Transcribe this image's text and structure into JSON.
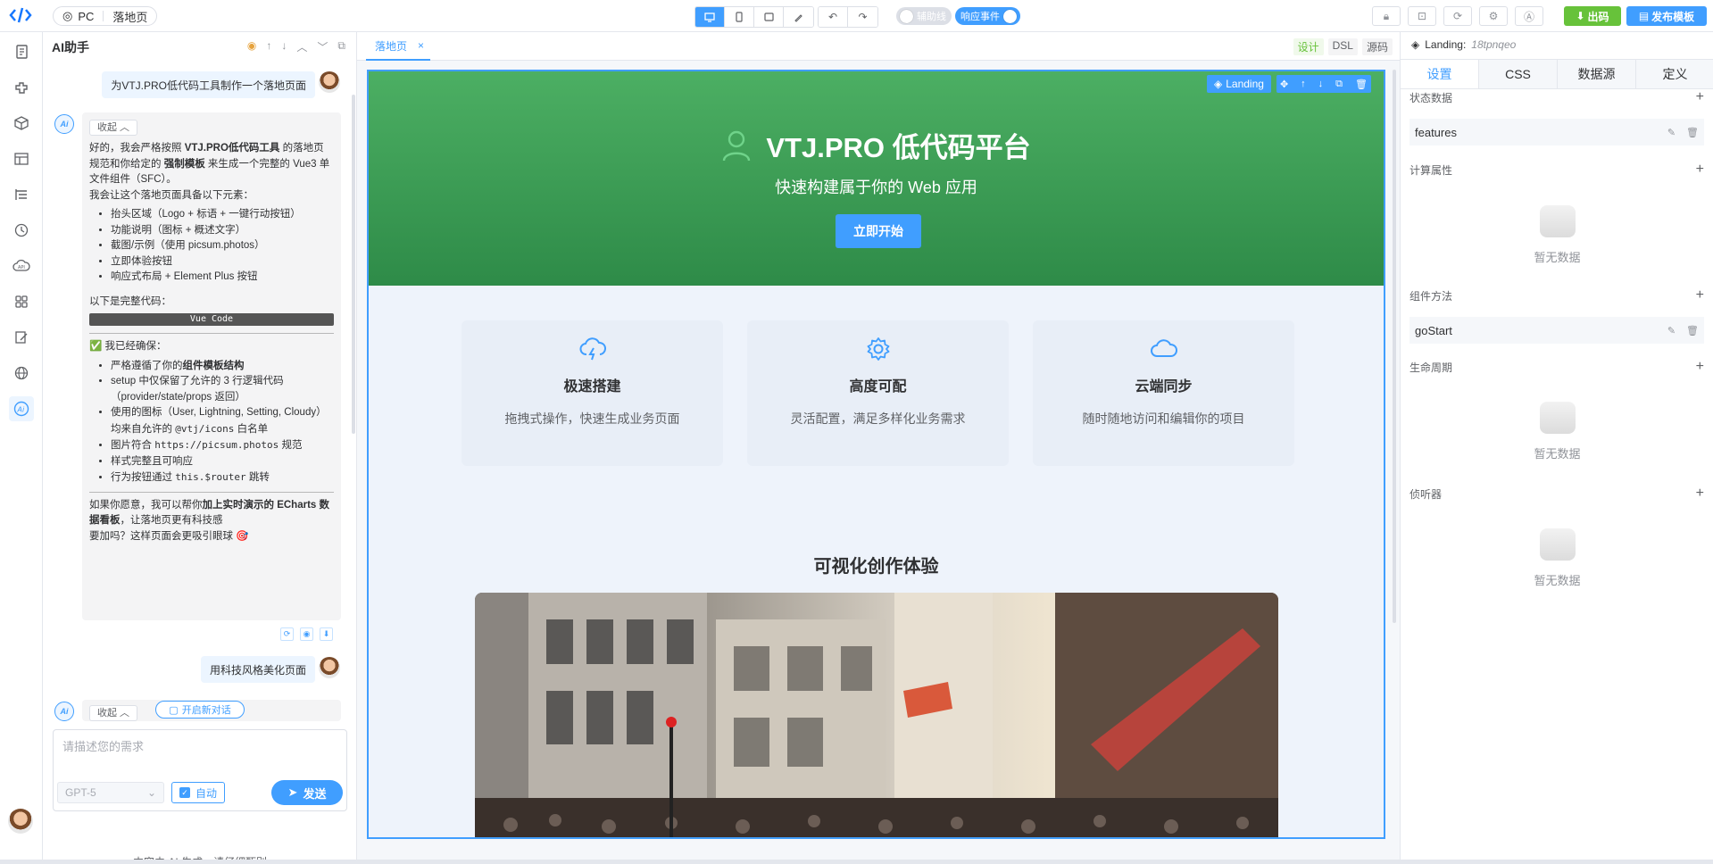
{
  "topbar": {
    "platform": "PC",
    "page_name": "落地页",
    "toggle_guides": "辅助线",
    "toggle_events": "响应事件",
    "export_label": "出码",
    "publish_label": "发布模板"
  },
  "chat": {
    "title": "AI助手",
    "messages": [
      {
        "role": "user",
        "text": "为VTJ.PRO低代码工具制作一个落地页面"
      },
      {
        "role": "ai",
        "collapse": "收起"
      },
      {
        "role": "user",
        "text": "用科技风格美化页面"
      },
      {
        "role": "ai",
        "collapse": "收起"
      }
    ],
    "ai_reply": {
      "p1_a": "好的，我会严格按照 ",
      "p1_b": "VTJ.PRO低代码工具",
      "p1_c": " 的落地页规范和你给定的 ",
      "p1_d": "强制模板",
      "p1_e": " 来生成一个完整的 Vue3 单文件组件（SFC）。",
      "p2": "我会让这个落地页面具备以下元素：",
      "list1": [
        "抬头区域（Logo + 标语 + 一键行动按钮）",
        "功能说明（图标 + 概述文字）",
        "截图/示例（使用 picsum.photos）",
        "立即体验按钮",
        "响应式布局 + Element Plus 按钮"
      ],
      "p3": "以下是完整代码：",
      "code_label": "Vue Code",
      "p4": "✅ 我已经确保：",
      "list2_0_a": "严格遵循了你的",
      "list2_0_b": "组件模板结构",
      "list2_1": "setup 中仅保留了允许的 3 行逻辑代码（provider/state/props 返回）",
      "list2_2_a": "使用的图标（User, Lightning, Setting, Cloudy）均来自允许的 ",
      "list2_2_b": "@vtj/icons",
      "list2_2_c": " 白名单",
      "list2_3_a": "图片符合 ",
      "list2_3_b": "https://picsum.photos",
      "list2_3_c": " 规范",
      "list2_4": "样式完整且可响应",
      "list2_5_a": "行为按钮通过 ",
      "list2_5_b": "this.$router",
      "list2_5_c": " 跳转",
      "p5_a": "如果你愿意，我可以帮你",
      "p5_b": "加上实时演示的 ECharts 数据看板",
      "p5_c": "，让落地页更有科技感",
      "p6": "要加吗？这样页面会更吸引眼球 🎯"
    },
    "new_chat": "开启新对话",
    "input_placeholder": "请描述您的需求",
    "model": "GPT-5",
    "auto_label": "自动",
    "send_label": "发送",
    "disclaimer": "内容由 AI 生成，请仔细甄别"
  },
  "editor": {
    "tab_label": "落地页",
    "modes": [
      "设计",
      "DSL",
      "源码"
    ],
    "selected_component": "Landing"
  },
  "landing": {
    "hero_title": "VTJ.PRO 低代码平台",
    "hero_subtitle": "快速构建属于你的 Web 应用",
    "hero_button": "立即开始",
    "features": [
      {
        "icon": "lightning-cloud-icon",
        "title": "极速搭建",
        "desc": "拖拽式操作，快速生成业务页面"
      },
      {
        "icon": "setting-icon",
        "title": "高度可配",
        "desc": "灵活配置，满足多样化业务需求"
      },
      {
        "icon": "cloudy-icon",
        "title": "云端同步",
        "desc": "随时随地访问和编辑你的项目"
      }
    ],
    "showcase_title": "可视化创作体验"
  },
  "inspector": {
    "component_name": "Landing:",
    "component_id": "18tpnqeo",
    "tabs": [
      "设置",
      "CSS",
      "数据源",
      "定义"
    ],
    "sections": {
      "state": "状态数据",
      "computed": "计算属性",
      "methods": "组件方法",
      "lifecycle": "生命周期",
      "watchers": "侦听器"
    },
    "state_items": [
      "features"
    ],
    "method_items": [
      "goStart"
    ],
    "empty_text": "暂无数据"
  },
  "colors": {
    "primary": "#409eff",
    "success": "#67c23a",
    "hero_green": "#3a9d55"
  }
}
